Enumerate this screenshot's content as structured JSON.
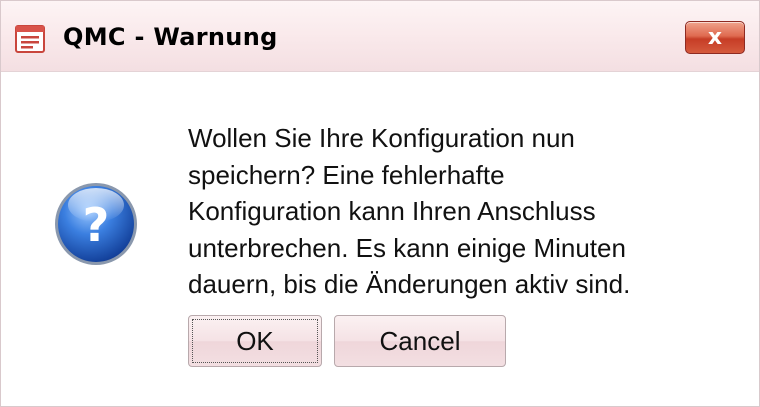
{
  "window": {
    "title": "QMC - Warnung",
    "close_label": "x"
  },
  "message": {
    "text": "Wollen Sie Ihre Konfiguration nun\nspeichern? Eine fehlerhafte\nKonfiguration kann Ihren Anschluss\nunterbrechen. Es kann einige Minuten\ndauern, bis die Änderungen aktiv sind."
  },
  "buttons": {
    "ok_label": "OK",
    "cancel_label": "Cancel"
  },
  "icons": {
    "app": "document-icon",
    "message": "question-icon"
  },
  "colors": {
    "titlebar": "#f9e8ea",
    "close_button": "#d55a3d",
    "question_icon": "#2f6fd0",
    "button_face": "#f5e2e5"
  }
}
